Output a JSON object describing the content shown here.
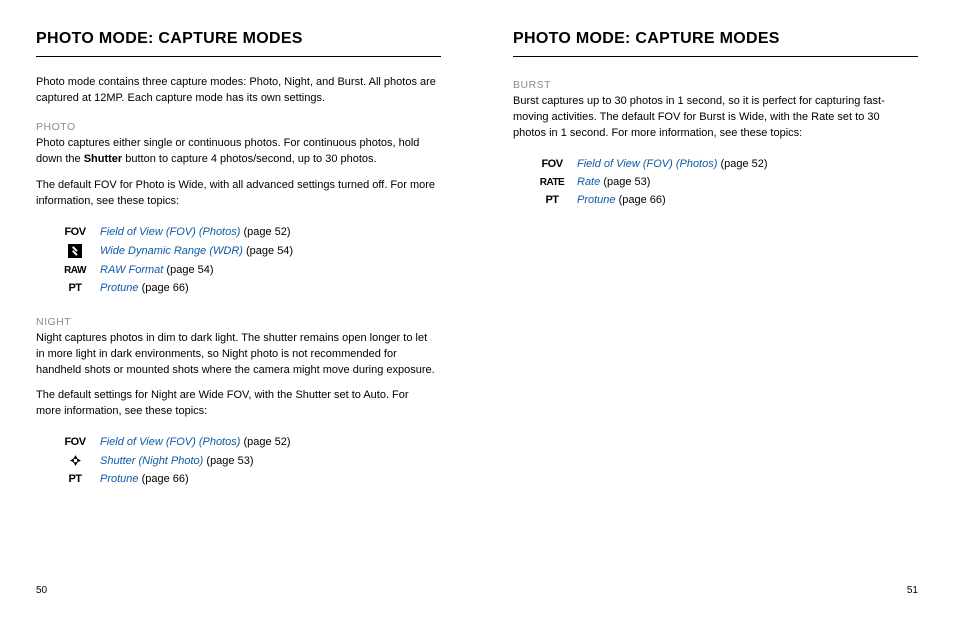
{
  "left": {
    "title": "PHOTO MODE: CAPTURE MODES",
    "intro": "Photo mode contains three capture modes: Photo, Night, and Burst. All photos are captured at 12MP. Each capture mode has its own settings.",
    "photo": {
      "label": "PHOTO",
      "p1a": "Photo captures either single or continuous photos. For continuous photos, hold down the ",
      "p1bold": "Shutter",
      "p1b": " button to capture 4 photos/second, up to 30 photos.",
      "p2": "The default FOV for Photo is Wide, with all advanced settings turned off. For more information, see these topics:",
      "links": [
        {
          "icon_text": "FOV",
          "link": "Field of View (FOV) (Photos)",
          "ref": "(page 52)"
        },
        {
          "icon_kind": "wdr",
          "link": "Wide Dynamic Range (WDR)",
          "ref": "(page 54)"
        },
        {
          "icon_text": "RAW",
          "link": "RAW Format",
          "ref": "(page 54)"
        },
        {
          "icon_text": "PT",
          "link": "Protune",
          "ref": "(page 66)"
        }
      ]
    },
    "night": {
      "label": "NIGHT",
      "p1": "Night captures photos in dim to dark light. The shutter remains open longer to let in more light in dark environments, so Night photo is not recommended for handheld shots or mounted shots where the camera might move during exposure.",
      "p2": "The default settings for Night are Wide FOV, with the Shutter set to Auto. For more information, see these topics:",
      "links": [
        {
          "icon_text": "FOV",
          "link": "Field of View (FOV) (Photos)",
          "ref": "(page 52)"
        },
        {
          "icon_kind": "aperture",
          "link": "Shutter (Night Photo)",
          "ref": "(page 53)"
        },
        {
          "icon_text": "PT",
          "link": "Protune",
          "ref": "(page 66)"
        }
      ]
    },
    "page_number": "50"
  },
  "right": {
    "title": "PHOTO MODE: CAPTURE MODES",
    "burst": {
      "label": "BURST",
      "p1": "Burst captures up to 30 photos in 1 second, so it is perfect for capturing fast-moving activities. The default FOV for Burst is Wide, with the Rate set to 30 photos in 1 second. For more information, see these topics:",
      "links": [
        {
          "icon_text": "FOV",
          "link": "Field of View (FOV) (Photos)",
          "ref": "(page 52)"
        },
        {
          "icon_text": "RATE",
          "link": "Rate",
          "ref": "(page 53)"
        },
        {
          "icon_text": "PT",
          "link": "Protune",
          "ref": "(page 66)"
        }
      ]
    },
    "page_number": "51"
  }
}
